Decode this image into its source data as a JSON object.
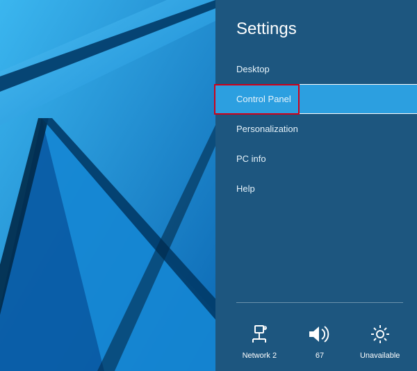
{
  "panel": {
    "title": "Settings",
    "items": [
      {
        "label": "Desktop",
        "selected": false
      },
      {
        "label": "Control Panel",
        "selected": true,
        "highlighted": true
      },
      {
        "label": "Personalization",
        "selected": false
      },
      {
        "label": "PC info",
        "selected": false
      },
      {
        "label": "Help",
        "selected": false
      }
    ]
  },
  "quick_actions": {
    "network": {
      "label": "Network  2",
      "icon": "network-icon"
    },
    "volume": {
      "label": "67",
      "icon": "volume-icon"
    },
    "brightness": {
      "label": "Unavailable",
      "icon": "brightness-icon"
    }
  },
  "colors": {
    "panel_bg": "#1d567f",
    "selected_bg": "#2c9fe0",
    "highlight_border": "#d00018"
  }
}
